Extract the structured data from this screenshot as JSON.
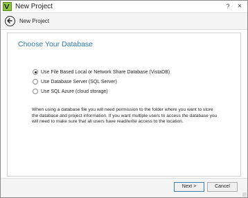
{
  "window": {
    "title": "New Project",
    "help_glyph": "?",
    "close_glyph": "×",
    "app_icon": "vistadb-logo-icon"
  },
  "nav": {
    "title": "New Project",
    "back_icon": "back-arrow-icon"
  },
  "page": {
    "heading": "Choose Your Database",
    "options": [
      {
        "label": "Use File Based Local or Network Share Database (VistaDB)",
        "selected": true
      },
      {
        "label": "Use Database Server (SQL Server)",
        "selected": false
      },
      {
        "label": "Use SQL Azure (cloud storage)",
        "selected": false
      }
    ],
    "info": "When using a database file you will need permission to the folder where you want to store the database and project information. If you want multiple users to access the database you will need to make sure that all users have read/write access to the location."
  },
  "footer": {
    "next_label": "Next >",
    "cancel_label": "Cancel"
  },
  "colors": {
    "heading": "#2a78b7",
    "app_icon": "#8cc63f"
  }
}
